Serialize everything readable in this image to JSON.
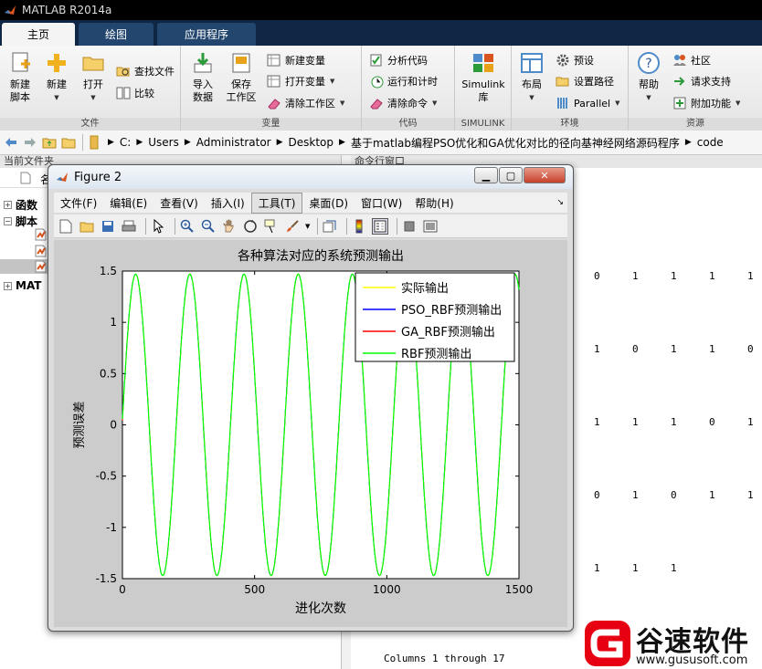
{
  "app": {
    "title": "MATLAB R2014a"
  },
  "ribbon_tabs": [
    "主页",
    "绘图",
    "应用程序"
  ],
  "ribbon": {
    "file": {
      "label": "文件",
      "new_script": "新建\n脚本",
      "new": "新建",
      "open": "打开",
      "find_files": "查找文件",
      "compare": "比较"
    },
    "variable": {
      "label": "变量",
      "import": "导入\n数据",
      "save_ws": "保存\n工作区",
      "new_var": "新建变量",
      "open_var": "打开变量",
      "clear_ws": "清除工作区"
    },
    "code": {
      "label": "代码",
      "analyze": "分析代码",
      "run_time": "运行和计时",
      "clear_cmd": "清除命令"
    },
    "simulink": {
      "label": "SIMULINK",
      "library": "Simulink\n库"
    },
    "environment": {
      "label": "环境",
      "layout": "布局",
      "preferences": "预设",
      "set_path": "设置路径",
      "parallel": "Parallel"
    },
    "resources": {
      "label": "资源",
      "help": "帮助",
      "community": "社区",
      "support": "请求支持",
      "addons": "附加功能"
    }
  },
  "address": {
    "crumbs": [
      "C:",
      "Users",
      "Administrator",
      "Desktop",
      "基于matlab编程PSO优化和GA优化对比的径向基神经网络源码程序",
      "code"
    ]
  },
  "left_panel": {
    "header": "当前文件夹",
    "col_name": "名",
    "tree": [
      "函数",
      "脚本",
      "MAT"
    ]
  },
  "command_window": {
    "header": "命令行窗口",
    "matrix": [
      [
        "0",
        "1",
        "1",
        "1",
        "1"
      ],
      [
        "1",
        "0",
        "1",
        "1",
        "0"
      ],
      [
        "1",
        "1",
        "1",
        "0",
        "1"
      ],
      [
        "0",
        "1",
        "0",
        "1",
        "1"
      ],
      [
        "1",
        "1",
        "1"
      ]
    ],
    "columns_text": "Columns 1 through 17"
  },
  "figure": {
    "title": "Figure 2",
    "menu": [
      "文件(F)",
      "编辑(E)",
      "查看(V)",
      "插入(I)",
      "工具(T)",
      "桌面(D)",
      "窗口(W)",
      "帮助(H)"
    ],
    "active_menu_index": 4
  },
  "chart_data": {
    "type": "line",
    "title": "各种算法对应的系统预测输出",
    "xlabel": "进化次数",
    "ylabel": "预测误差",
    "xlim": [
      0,
      1500
    ],
    "ylim": [
      -1.5,
      1.5
    ],
    "xticks": [
      "0",
      "500",
      "1000",
      "1500"
    ],
    "yticks": [
      "1.5",
      "1",
      "0.5",
      "0",
      "-0.5",
      "-1",
      "-1.5"
    ],
    "legend_position": "top-right",
    "series": [
      {
        "name": "实际输出",
        "color": "#ffff00"
      },
      {
        "name": "PSO_RBF预测输出",
        "color": "#0000ff"
      },
      {
        "name": "GA_RBF预测输出",
        "color": "#ff0000"
      },
      {
        "name": "RBF预测输出",
        "color": "#00ff00"
      }
    ],
    "wave": {
      "amplitude": 1.47,
      "period": 205,
      "phase_peak_x": 50
    }
  },
  "watermark": {
    "name": "谷速软件",
    "url": "www.gususoft.com"
  },
  "colors": {
    "ribbon_tab_bg": "#0f2744",
    "title_bg": "#000000",
    "watermark_red": "#e60012"
  }
}
